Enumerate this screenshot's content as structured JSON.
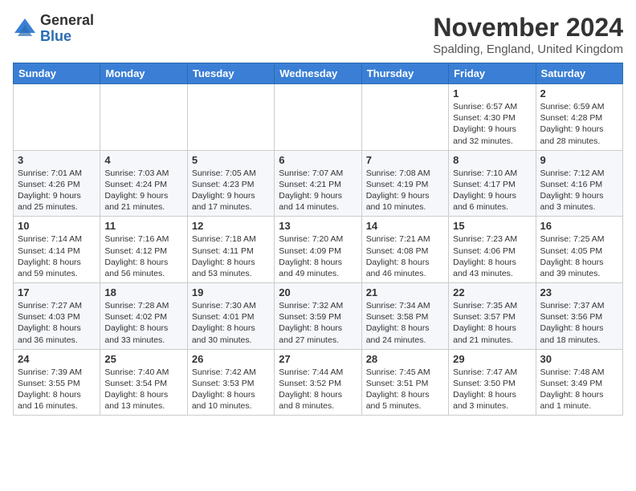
{
  "logo": {
    "general": "General",
    "blue": "Blue"
  },
  "title": "November 2024",
  "location": "Spalding, England, United Kingdom",
  "weekdays": [
    "Sunday",
    "Monday",
    "Tuesday",
    "Wednesday",
    "Thursday",
    "Friday",
    "Saturday"
  ],
  "weeks": [
    [
      {
        "day": "",
        "content": ""
      },
      {
        "day": "",
        "content": ""
      },
      {
        "day": "",
        "content": ""
      },
      {
        "day": "",
        "content": ""
      },
      {
        "day": "",
        "content": ""
      },
      {
        "day": "1",
        "content": "Sunrise: 6:57 AM\nSunset: 4:30 PM\nDaylight: 9 hours\nand 32 minutes."
      },
      {
        "day": "2",
        "content": "Sunrise: 6:59 AM\nSunset: 4:28 PM\nDaylight: 9 hours\nand 28 minutes."
      }
    ],
    [
      {
        "day": "3",
        "content": "Sunrise: 7:01 AM\nSunset: 4:26 PM\nDaylight: 9 hours\nand 25 minutes."
      },
      {
        "day": "4",
        "content": "Sunrise: 7:03 AM\nSunset: 4:24 PM\nDaylight: 9 hours\nand 21 minutes."
      },
      {
        "day": "5",
        "content": "Sunrise: 7:05 AM\nSunset: 4:23 PM\nDaylight: 9 hours\nand 17 minutes."
      },
      {
        "day": "6",
        "content": "Sunrise: 7:07 AM\nSunset: 4:21 PM\nDaylight: 9 hours\nand 14 minutes."
      },
      {
        "day": "7",
        "content": "Sunrise: 7:08 AM\nSunset: 4:19 PM\nDaylight: 9 hours\nand 10 minutes."
      },
      {
        "day": "8",
        "content": "Sunrise: 7:10 AM\nSunset: 4:17 PM\nDaylight: 9 hours\nand 6 minutes."
      },
      {
        "day": "9",
        "content": "Sunrise: 7:12 AM\nSunset: 4:16 PM\nDaylight: 9 hours\nand 3 minutes."
      }
    ],
    [
      {
        "day": "10",
        "content": "Sunrise: 7:14 AM\nSunset: 4:14 PM\nDaylight: 8 hours\nand 59 minutes."
      },
      {
        "day": "11",
        "content": "Sunrise: 7:16 AM\nSunset: 4:12 PM\nDaylight: 8 hours\nand 56 minutes."
      },
      {
        "day": "12",
        "content": "Sunrise: 7:18 AM\nSunset: 4:11 PM\nDaylight: 8 hours\nand 53 minutes."
      },
      {
        "day": "13",
        "content": "Sunrise: 7:20 AM\nSunset: 4:09 PM\nDaylight: 8 hours\nand 49 minutes."
      },
      {
        "day": "14",
        "content": "Sunrise: 7:21 AM\nSunset: 4:08 PM\nDaylight: 8 hours\nand 46 minutes."
      },
      {
        "day": "15",
        "content": "Sunrise: 7:23 AM\nSunset: 4:06 PM\nDaylight: 8 hours\nand 43 minutes."
      },
      {
        "day": "16",
        "content": "Sunrise: 7:25 AM\nSunset: 4:05 PM\nDaylight: 8 hours\nand 39 minutes."
      }
    ],
    [
      {
        "day": "17",
        "content": "Sunrise: 7:27 AM\nSunset: 4:03 PM\nDaylight: 8 hours\nand 36 minutes."
      },
      {
        "day": "18",
        "content": "Sunrise: 7:28 AM\nSunset: 4:02 PM\nDaylight: 8 hours\nand 33 minutes."
      },
      {
        "day": "19",
        "content": "Sunrise: 7:30 AM\nSunset: 4:01 PM\nDaylight: 8 hours\nand 30 minutes."
      },
      {
        "day": "20",
        "content": "Sunrise: 7:32 AM\nSunset: 3:59 PM\nDaylight: 8 hours\nand 27 minutes."
      },
      {
        "day": "21",
        "content": "Sunrise: 7:34 AM\nSunset: 3:58 PM\nDaylight: 8 hours\nand 24 minutes."
      },
      {
        "day": "22",
        "content": "Sunrise: 7:35 AM\nSunset: 3:57 PM\nDaylight: 8 hours\nand 21 minutes."
      },
      {
        "day": "23",
        "content": "Sunrise: 7:37 AM\nSunset: 3:56 PM\nDaylight: 8 hours\nand 18 minutes."
      }
    ],
    [
      {
        "day": "24",
        "content": "Sunrise: 7:39 AM\nSunset: 3:55 PM\nDaylight: 8 hours\nand 16 minutes."
      },
      {
        "day": "25",
        "content": "Sunrise: 7:40 AM\nSunset: 3:54 PM\nDaylight: 8 hours\nand 13 minutes."
      },
      {
        "day": "26",
        "content": "Sunrise: 7:42 AM\nSunset: 3:53 PM\nDaylight: 8 hours\nand 10 minutes."
      },
      {
        "day": "27",
        "content": "Sunrise: 7:44 AM\nSunset: 3:52 PM\nDaylight: 8 hours\nand 8 minutes."
      },
      {
        "day": "28",
        "content": "Sunrise: 7:45 AM\nSunset: 3:51 PM\nDaylight: 8 hours\nand 5 minutes."
      },
      {
        "day": "29",
        "content": "Sunrise: 7:47 AM\nSunset: 3:50 PM\nDaylight: 8 hours\nand 3 minutes."
      },
      {
        "day": "30",
        "content": "Sunrise: 7:48 AM\nSunset: 3:49 PM\nDaylight: 8 hours\nand 1 minute."
      }
    ]
  ]
}
